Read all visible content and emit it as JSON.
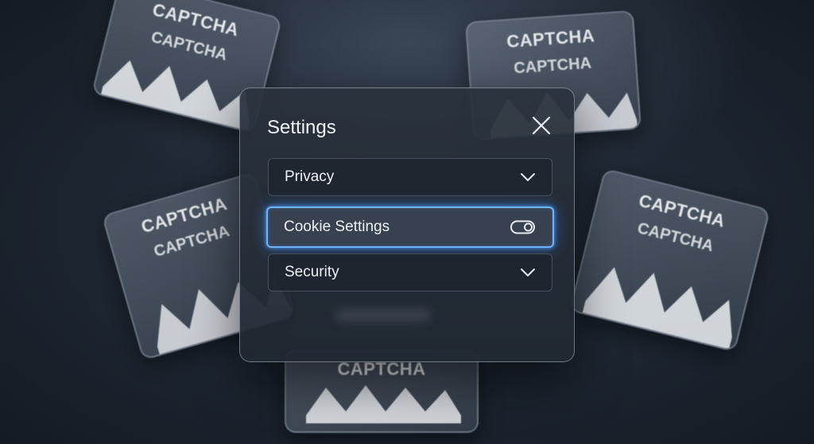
{
  "background": {
    "captcha_cards": [
      {
        "title": "CAPTCHA",
        "subtitle": "CAPTCHA"
      },
      {
        "title": "CAPTCHA",
        "subtitle": "CAPTCHA"
      },
      {
        "title": "CAPTCHA",
        "subtitle": "CAPTCHA"
      },
      {
        "title": "CAPTCHA",
        "subtitle": "CAPTCHA"
      },
      {
        "title": "CAPTCHA",
        "subtitle": ""
      }
    ]
  },
  "modal": {
    "title": "Settings",
    "close_icon": "close-icon",
    "items": [
      {
        "label": "Privacy",
        "control": "chevron-down-icon",
        "active": false
      },
      {
        "label": "Cookie Settings",
        "control": "toggle-switch",
        "active": true
      },
      {
        "label": "Security",
        "control": "chevron-down-icon",
        "active": false
      }
    ]
  },
  "colors": {
    "accent_glow": "#6fb4ff",
    "text": "#eef0f3"
  }
}
